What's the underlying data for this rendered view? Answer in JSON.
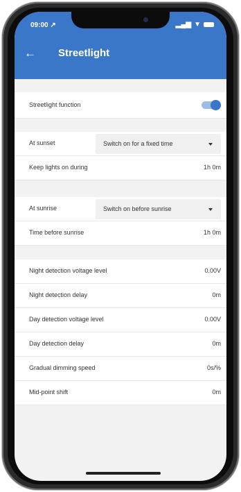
{
  "status_bar": {
    "time": "09:00",
    "time_arrow": "↗",
    "signal": "▂▄▆",
    "wifi": "▼"
  },
  "header": {
    "back_icon": "←",
    "title": "Streetlight"
  },
  "streetlight_function": {
    "label": "Streetlight function",
    "enabled": true
  },
  "sunset": {
    "label": "At sunset",
    "selected_option": "Switch on for a fixed time",
    "keep_on_label": "Keep lights on during",
    "keep_on_value": "1h 0m"
  },
  "sunrise": {
    "label": "At sunrise",
    "selected_option": "Switch on before sunrise",
    "time_before_label": "Time before sunrise",
    "time_before_value": "1h 0m"
  },
  "detection": [
    {
      "label": "Night detection voltage level",
      "value": "0.00V"
    },
    {
      "label": "Night detection delay",
      "value": "0m"
    },
    {
      "label": "Day detection voltage level",
      "value": "0.00V"
    },
    {
      "label": "Day detection delay",
      "value": "0m"
    },
    {
      "label": "Gradual dimming speed",
      "value": "0s/%"
    },
    {
      "label": "Mid-point shift",
      "value": "0m"
    }
  ],
  "colors": {
    "accent": "#3b77c8",
    "toggle_track": "#9cbce6",
    "background": "#f2f2f2"
  }
}
